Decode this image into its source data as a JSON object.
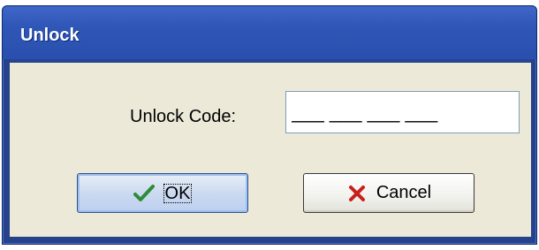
{
  "window": {
    "title": "Unlock"
  },
  "form": {
    "unlock_code_label": "Unlock Code:",
    "unlock_code_value": "___ ___ ___ ___"
  },
  "buttons": {
    "ok_label": "OK",
    "cancel_label": "Cancel"
  },
  "icons": {
    "ok": "checkmark-icon",
    "cancel": "x-icon"
  },
  "colors": {
    "titlebar": "#2f56b7",
    "client_background": "#ece9d8",
    "checkmark": "#2e8b3a",
    "x_mark": "#c8201b"
  }
}
